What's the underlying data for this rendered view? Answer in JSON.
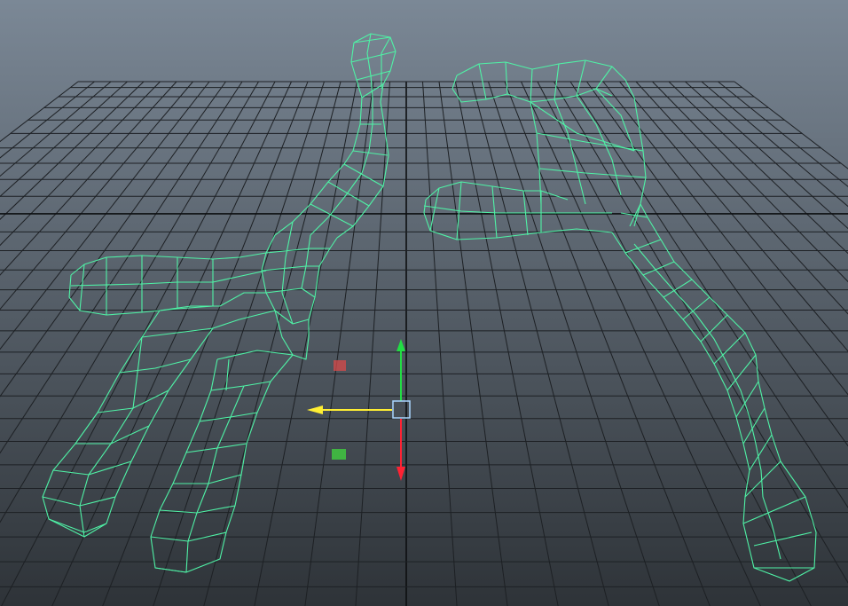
{
  "viewport": {
    "background_top": "#7b8896",
    "background_bottom": "#2e3338",
    "grid_color": "#1d2024",
    "axis_color": "#0c0e10",
    "wireframe_color": "#4ff2a6"
  },
  "manipulator": {
    "x_axis_color": "#ffee33",
    "y_axis_color": "#22dd44",
    "z_axis_color": "#ff2233",
    "center_color": "#a9d6ff",
    "plane_handle_xy_color": "#d84a4a",
    "plane_handle_xz_color": "#40c040"
  },
  "scene": {
    "objects": [
      {
        "name": "left-hand-wireframe",
        "icon": "wireframe-mesh"
      },
      {
        "name": "right-hand-wireframe",
        "icon": "wireframe-mesh"
      }
    ]
  }
}
